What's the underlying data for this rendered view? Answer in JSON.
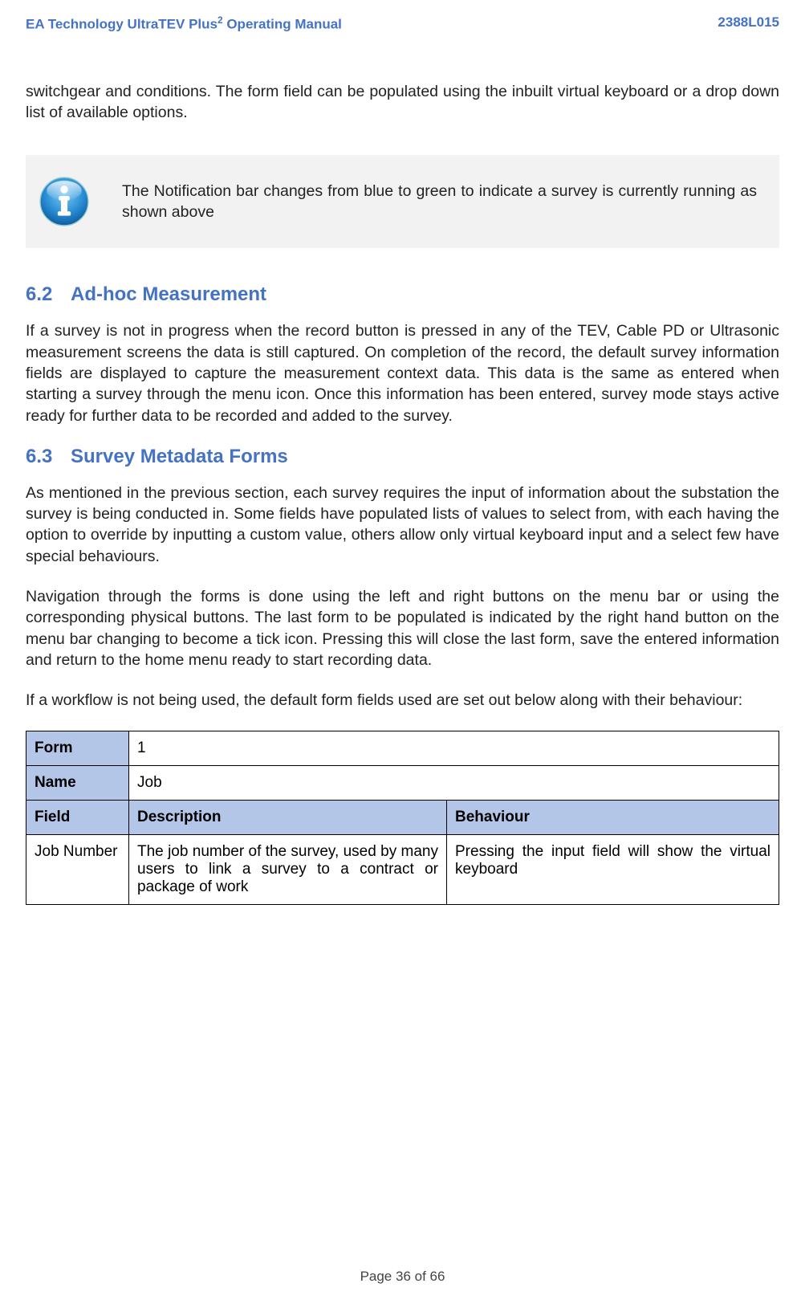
{
  "header": {
    "left_prefix": "EA Technology UltraTEV Plus",
    "left_sup": "2",
    "left_suffix": " Operating Manual",
    "right": "2388L015"
  },
  "intro_para": "switchgear and conditions. The form field can be populated using the inbuilt virtual keyboard or a drop down list of available options.",
  "info_box": {
    "text": "The Notification bar changes from blue to green to indicate a survey is currently running as shown above"
  },
  "section_62": {
    "num": "6.2",
    "title": "Ad-hoc Measurement",
    "para": "If a survey is not in progress when the record button is pressed in any of the TEV, Cable PD or Ultrasonic measurement screens the data is still captured. On completion of the record, the default survey information fields are displayed to capture the measurement context data. This data is the same as entered when starting a survey through the menu icon. Once this information has been entered, survey mode stays active ready for further data to be recorded and added to the survey."
  },
  "section_63": {
    "num": "6.3",
    "title": "Survey Metadata Forms",
    "para1": "As mentioned in the previous section, each survey requires the input of information about the substation the survey is being conducted in. Some fields have populated lists of values to select from, with each having the option to override by inputting a custom value, others allow only virtual keyboard input and a select few have special behaviours.",
    "para2": "Navigation through the forms is done using the left and right buttons on the menu bar or using the corresponding physical buttons. The last form to be populated is indicated by the right hand button on the menu bar changing to become a tick icon. Pressing this will close the last form, save the entered information and return to the home menu ready to start recording data.",
    "para3": "If a workflow is not being used, the default form fields used are set out below along with their behaviour:"
  },
  "table": {
    "form_label": "Form",
    "form_value": "1",
    "name_label": "Name",
    "name_value": "Job",
    "col_field": "Field",
    "col_desc": "Description",
    "col_beh": "Behaviour",
    "rows": [
      {
        "field": "Job Number",
        "desc": "The job number of the survey, used by many users to link a survey to a contract or package of work",
        "beh": "Pressing the input field will show the virtual keyboard"
      }
    ]
  },
  "footer": "Page 36 of 66"
}
